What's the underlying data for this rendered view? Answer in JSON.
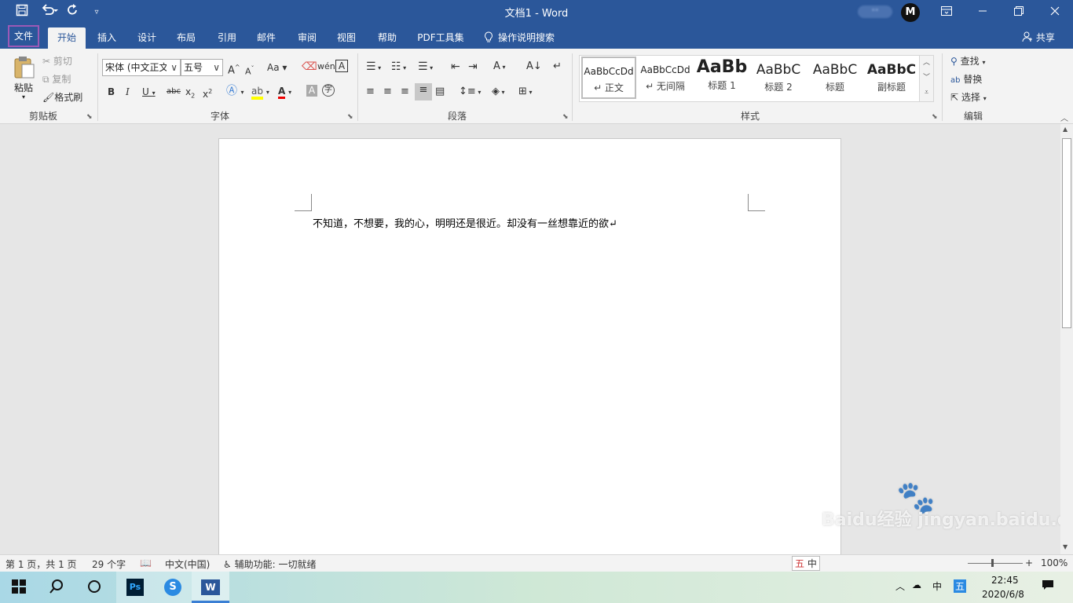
{
  "titlebar": {
    "title": "文档1  -  Word",
    "account": "**",
    "avatar_letter": "M",
    "icons": [
      "save-icon",
      "undo-icon",
      "redo-icon",
      "customize-qat-icon",
      "ribbon-display-icon",
      "minimize-icon",
      "restore-icon",
      "close-icon"
    ]
  },
  "tabs": {
    "file": "文件",
    "home": "开始",
    "insert": "插入",
    "design": "设计",
    "layout": "布局",
    "references": "引用",
    "mailings": "邮件",
    "review": "审阅",
    "view": "视图",
    "help": "帮助",
    "pdf": "PDF工具集",
    "tell_me": "操作说明搜索",
    "share": "共享"
  },
  "ribbon": {
    "clipboard": {
      "paste": "粘贴",
      "cut": "剪切",
      "copy": "复制",
      "format_painter": "格式刷",
      "label": "剪贴板"
    },
    "font": {
      "font_name": "宋体 (中文正文",
      "font_size": "五号",
      "label": "字体"
    },
    "paragraph": {
      "label": "段落"
    },
    "styles": {
      "label": "样式",
      "items": [
        {
          "preview": "AaBbCcDd",
          "name": "↵ 正文"
        },
        {
          "preview": "AaBbCcDd",
          "name": "↵ 无间隔"
        },
        {
          "preview": "AaBb",
          "name": "标题 1"
        },
        {
          "preview": "AaBbC",
          "name": "标题 2"
        },
        {
          "preview": "AaBbC",
          "name": "标题"
        },
        {
          "preview": "AaBbC",
          "name": "副标题"
        }
      ]
    },
    "editing": {
      "find": "查找",
      "replace": "替换",
      "select": "选择",
      "label": "编辑"
    }
  },
  "document": {
    "text": "不知道，不想要，我的心，明明还是很近。却没有一丝想靠近的欲↵"
  },
  "statusbar": {
    "page": "第 1 页，共 1 页",
    "words": "29 个字",
    "language": "中文(中国)",
    "accessibility": "辅助功能: 一切就绪",
    "zoom": "100%",
    "ime": "中"
  },
  "taskbar": {
    "time": "22:45",
    "date": "2020/6/8",
    "ime_mode": "中",
    "ime_name": "五"
  },
  "watermark": "Baidu经验 jingyan.baidu.com",
  "colors": {
    "word_blue": "#2b579a",
    "file_tab_outline": "#9b59b6"
  }
}
